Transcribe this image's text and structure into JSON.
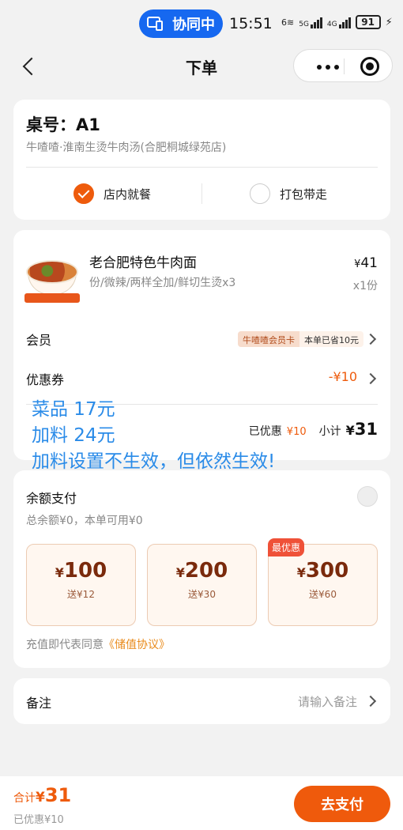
{
  "status_bar": {
    "collab_label": "协同中",
    "time": "15:51",
    "net1": "6",
    "net2": "5G",
    "net3": "4G",
    "battery": "91"
  },
  "nav": {
    "title": "下单"
  },
  "order_header": {
    "table_no": "桌号：A1",
    "store_name": "牛喳喳·淮南生烫牛肉汤(合肥桐城绿苑店)",
    "dine_in_label": "店内就餐",
    "takeaway_label": "打包带走",
    "selected": "dine_in"
  },
  "item": {
    "name": "老合肥特色牛肉面",
    "spec": "份/微辣/两样全加/鲜切生烫x3",
    "price_currency": "¥",
    "price": "41",
    "qty": "x1份"
  },
  "member": {
    "label": "会员",
    "card_tag": "牛喳喳会员卡",
    "saving_tag": "本单已省10元"
  },
  "coupon": {
    "label": "优惠券",
    "value": "-¥10"
  },
  "subtotal": {
    "discount_label": "已优惠",
    "discount": "¥10",
    "subtotal_label": "小计",
    "currency": "¥",
    "amount": "31"
  },
  "overlay_note": {
    "line1": "菜品 17元",
    "line2": "加料 24元",
    "line3": "加料设置不生效，但依然生效!"
  },
  "balance": {
    "title": "余额支付",
    "sub": "总余额¥0，本单可用¥0",
    "packages": [
      {
        "currency": "¥",
        "amount": "100",
        "gift": "送¥12"
      },
      {
        "currency": "¥",
        "amount": "200",
        "gift": "送¥30"
      },
      {
        "currency": "¥",
        "amount": "300",
        "gift": "送¥60",
        "badge": "最优惠"
      }
    ],
    "agree_prefix": "充值即代表同意",
    "agree_link": "《储值协议》"
  },
  "remark": {
    "label": "备注",
    "placeholder": "请输入备注"
  },
  "footer": {
    "total_label": "合计",
    "currency": "¥",
    "total": "31",
    "saved": "已优惠¥10",
    "pay_label": "去支付"
  },
  "colors": {
    "accent": "#ee5b0c",
    "collab_blue": "#1668f0",
    "overlay_blue": "#2a8be8"
  }
}
